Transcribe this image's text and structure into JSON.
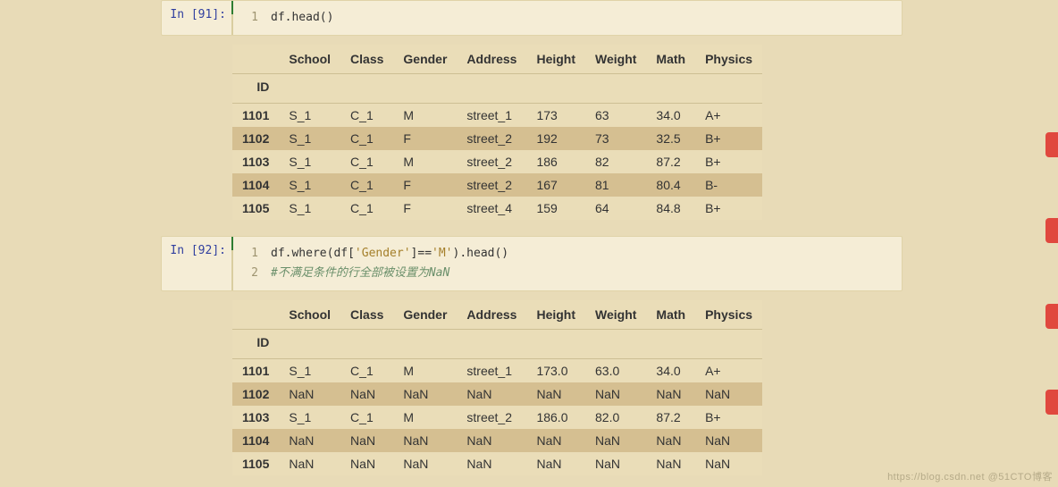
{
  "cells": [
    {
      "prompt": "In [91]:",
      "lines": [
        {
          "n": "1",
          "segs": [
            {
              "t": "df.head()",
              "cls": ""
            }
          ]
        }
      ]
    },
    {
      "prompt": "In [92]:",
      "lines": [
        {
          "n": "1",
          "segs": [
            {
              "t": "df.where(df[",
              "cls": ""
            },
            {
              "t": "'Gender'",
              "cls": "str"
            },
            {
              "t": "]==",
              "cls": ""
            },
            {
              "t": "'M'",
              "cls": "str"
            },
            {
              "t": ").head()",
              "cls": ""
            }
          ]
        },
        {
          "n": "2",
          "segs": [
            {
              "t": "#不满足条件的行全部被设置为NaN",
              "cls": "comment"
            }
          ]
        }
      ]
    }
  ],
  "table1": {
    "index_name": "ID",
    "columns": [
      "School",
      "Class",
      "Gender",
      "Address",
      "Height",
      "Weight",
      "Math",
      "Physics"
    ],
    "rows": [
      {
        "id": "1101",
        "v": [
          "S_1",
          "C_1",
          "M",
          "street_1",
          "173",
          "63",
          "34.0",
          "A+"
        ]
      },
      {
        "id": "1102",
        "v": [
          "S_1",
          "C_1",
          "F",
          "street_2",
          "192",
          "73",
          "32.5",
          "B+"
        ]
      },
      {
        "id": "1103",
        "v": [
          "S_1",
          "C_1",
          "M",
          "street_2",
          "186",
          "82",
          "87.2",
          "B+"
        ]
      },
      {
        "id": "1104",
        "v": [
          "S_1",
          "C_1",
          "F",
          "street_2",
          "167",
          "81",
          "80.4",
          "B-"
        ]
      },
      {
        "id": "1105",
        "v": [
          "S_1",
          "C_1",
          "F",
          "street_4",
          "159",
          "64",
          "84.8",
          "B+"
        ]
      }
    ]
  },
  "table2": {
    "index_name": "ID",
    "columns": [
      "School",
      "Class",
      "Gender",
      "Address",
      "Height",
      "Weight",
      "Math",
      "Physics"
    ],
    "rows": [
      {
        "id": "1101",
        "v": [
          "S_1",
          "C_1",
          "M",
          "street_1",
          "173.0",
          "63.0",
          "34.0",
          "A+"
        ]
      },
      {
        "id": "1102",
        "v": [
          "NaN",
          "NaN",
          "NaN",
          "NaN",
          "NaN",
          "NaN",
          "NaN",
          "NaN"
        ]
      },
      {
        "id": "1103",
        "v": [
          "S_1",
          "C_1",
          "M",
          "street_2",
          "186.0",
          "82.0",
          "87.2",
          "B+"
        ]
      },
      {
        "id": "1104",
        "v": [
          "NaN",
          "NaN",
          "NaN",
          "NaN",
          "NaN",
          "NaN",
          "NaN",
          "NaN"
        ]
      },
      {
        "id": "1105",
        "v": [
          "NaN",
          "NaN",
          "NaN",
          "NaN",
          "NaN",
          "NaN",
          "NaN",
          "NaN"
        ]
      }
    ]
  },
  "watermark": "https://blog.csdn.net  @51CTO博客"
}
